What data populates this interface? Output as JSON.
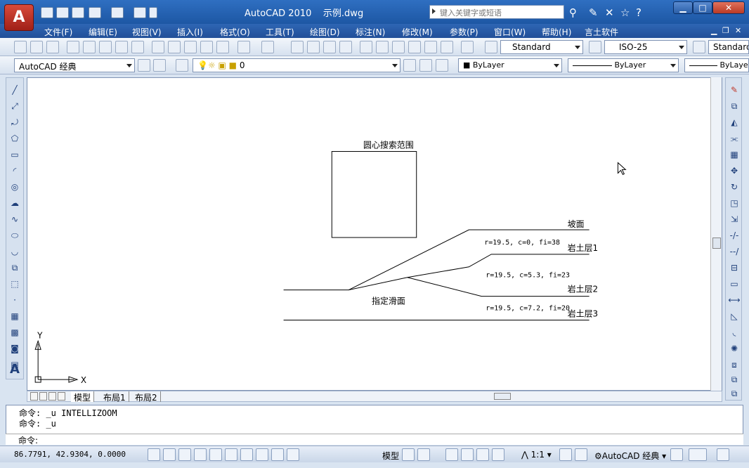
{
  "titlebar": {
    "app": "AutoCAD 2010",
    "document": "示例.dwg",
    "search_placeholder": "键入关键字或短语"
  },
  "menu": [
    "文件(F)",
    "编辑(E)",
    "视图(V)",
    "插入(I)",
    "格式(O)",
    "工具(T)",
    "绘图(D)",
    "标注(N)",
    "修改(M)",
    "参数(P)",
    "窗口(W)",
    "帮助(H)",
    "言土软件"
  ],
  "toolbar": {
    "text_style": "Standard",
    "dim_style": "ISO-25",
    "table_style": "Standard",
    "workspace": "AutoCAD 经典",
    "layer": "0",
    "color": "ByLayer",
    "linetype": "ByLayer",
    "lineweight": "ByLayer"
  },
  "drawing": {
    "box_label": "圆心搜索范围",
    "labels": {
      "slope": "坡面",
      "layer1": "岩土层1",
      "layer2": "岩土层2",
      "layer3": "岩土层3",
      "slip": "指定滑面",
      "p1": "r=19.5, c=0, fi=38",
      "p2": "r=19.5, c=5.3, fi=23",
      "p3": "r=19.5, c=7.2, fi=20"
    },
    "ucs_x": "X",
    "ucs_y": "Y"
  },
  "tabs": [
    "模型",
    "布局1",
    "布局2"
  ],
  "command": {
    "lines": [
      "命令: _u INTELLIZOOM",
      "命令: _u"
    ],
    "prompt": "命令:"
  },
  "status": {
    "coords": "86.7791, 42.9304, 0.0000",
    "model": "模型",
    "scale": "1:1",
    "workspace": "AutoCAD 经典"
  }
}
